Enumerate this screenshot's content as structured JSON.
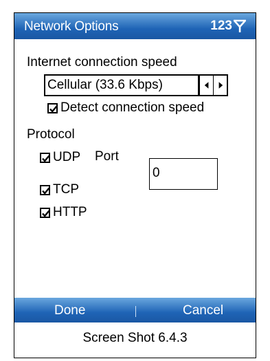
{
  "window": {
    "title": "Network Options",
    "status_text": "123",
    "status_icon": "signal-antenna-icon"
  },
  "speed": {
    "label": "Internet connection speed",
    "value": "Cellular (33.6 Kbps)",
    "left_icon": "arrow-left-icon",
    "right_icon": "arrow-right-icon",
    "detect_label": "Detect connection speed",
    "detect_checked": true
  },
  "protocol": {
    "label": "Protocol",
    "udp_label": "UDP",
    "udp_checked": true,
    "port_label": "Port",
    "port_value": "0",
    "tcp_label": "TCP",
    "tcp_checked": true,
    "http_label": "HTTP",
    "http_checked": true
  },
  "softkeys": {
    "left": "Done",
    "right": "Cancel"
  },
  "caption": "Screen Shot 6.4.3",
  "colors": {
    "titlebar": "#1f64b6",
    "text_on_bar": "#ffffff"
  }
}
